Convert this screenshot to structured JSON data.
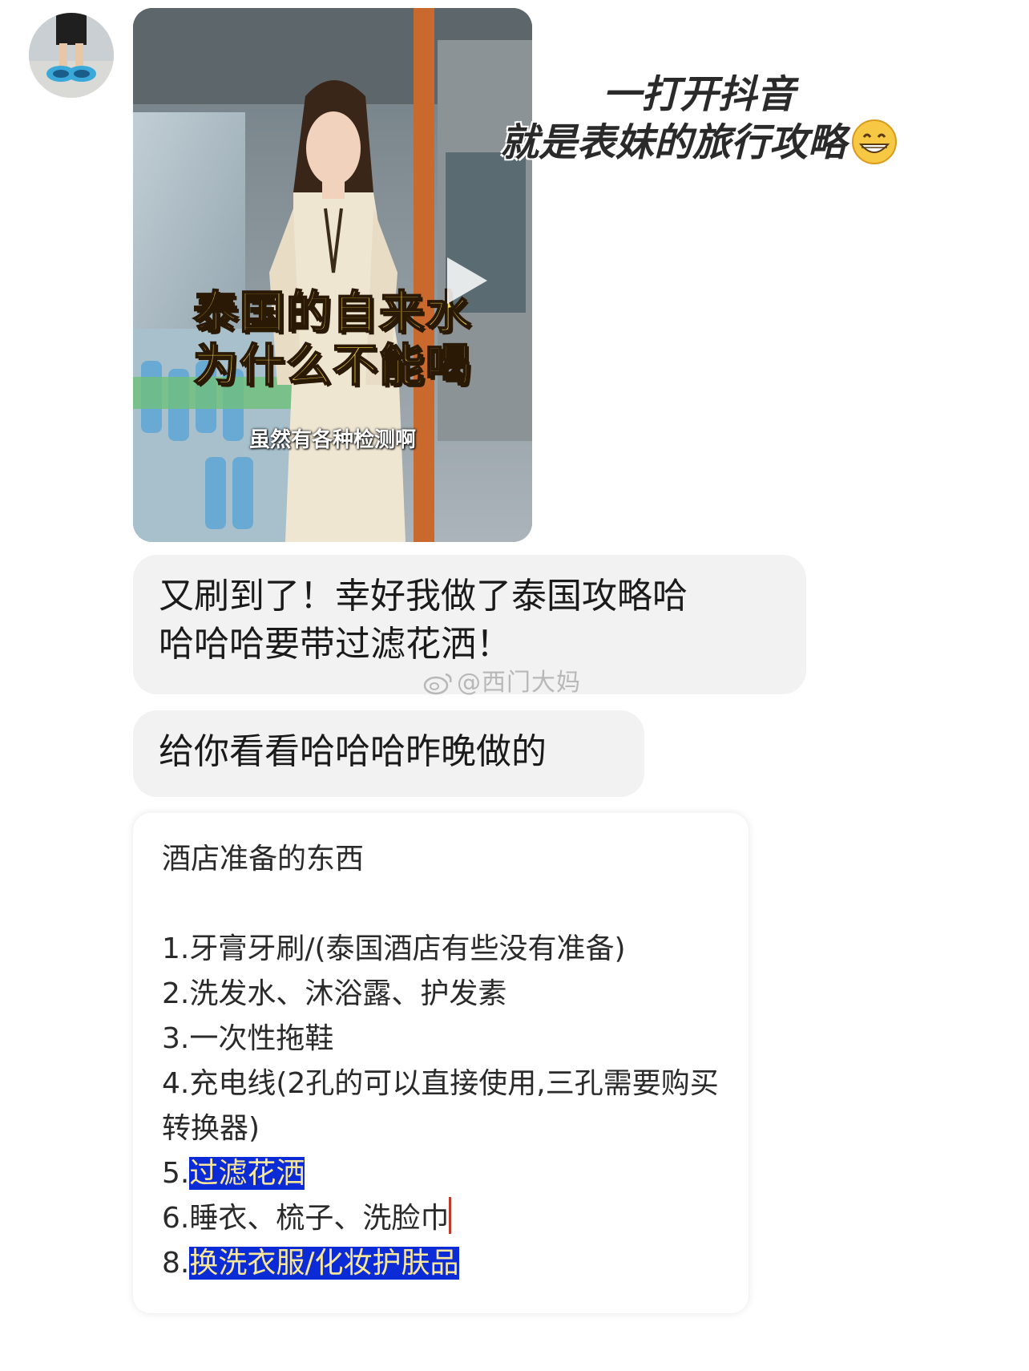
{
  "sender": {
    "avatar_icon": "avatar-photo"
  },
  "video_card": {
    "overlay_title_line1": "泰国的自来水",
    "overlay_title_line2": "为什么不能喝",
    "subtitle": "虽然有各种检测啊",
    "play_icon": "play-icon"
  },
  "sticker": {
    "line1": "一打开抖音",
    "line2": "就是表妹的旅行攻略",
    "emoji": "grinning-face-emoji"
  },
  "messages": [
    {
      "text_line1": "又刷到了！幸好我做了泰国攻略哈",
      "text_line2": "哈哈哈要带过滤花洒！"
    },
    {
      "text": "给你看看哈哈哈昨晚做的"
    }
  ],
  "watermark": "@西门大妈",
  "note": {
    "title": "酒店准备的东西",
    "items": [
      {
        "prefix": "1.",
        "text": "牙膏牙刷/(泰国酒店有些没有准备)"
      },
      {
        "prefix": "2.",
        "text": "洗发水、沐浴露、护发素"
      },
      {
        "prefix": "3.",
        "text": "一次性拖鞋"
      },
      {
        "prefix": "4.",
        "text": "充电线(2孔的可以直接使用,三孔需要购买转换器)"
      },
      {
        "prefix": "5.",
        "text": "过滤花洒",
        "highlighted": true
      },
      {
        "prefix": "6.",
        "text": "睡衣、梳子、洗脸巾"
      },
      {
        "prefix": "8.",
        "text": "换洗衣服/化妆护肤品",
        "highlighted": true
      }
    ],
    "highlight_color": "#0a2bd6"
  }
}
